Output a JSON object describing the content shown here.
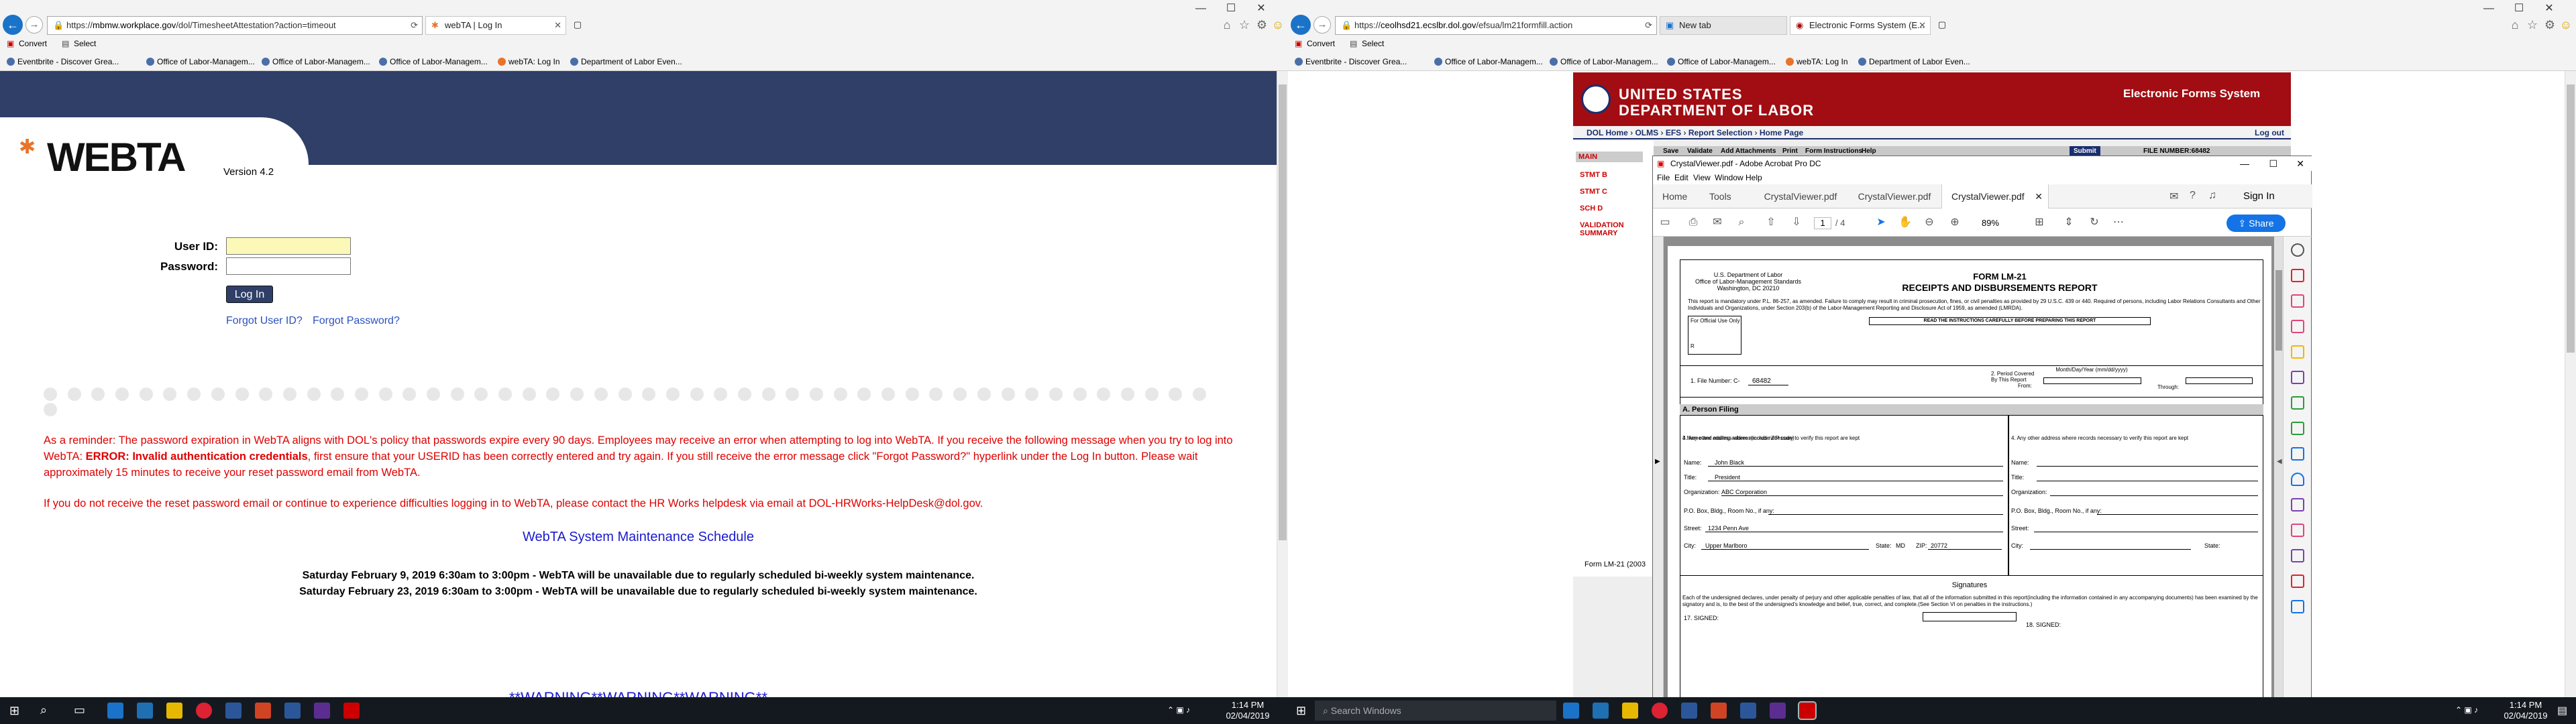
{
  "left_browser": {
    "url_prefix": "https://",
    "url_host": "mbmw.workplace.gov",
    "url_path": "/dol/TimesheetAttestation?action=timeout",
    "tab_title": "webTA | Log In",
    "cmd_convert": "Convert",
    "cmd_select": "Select",
    "favorites": [
      "Eventbrite - Discover Grea...",
      "Office of Labor-Managem...",
      "Office of Labor-Managem...",
      "Office of Labor-Managem...",
      "webTA: Log In",
      "Department of Labor Even..."
    ]
  },
  "webta": {
    "logo": "WEBTA",
    "version": "Version 4.2",
    "user_id_label": "User ID:",
    "password_label": "Password:",
    "login_button": "Log In",
    "forgot_user": "Forgot User ID?",
    "forgot_password": "Forgot Password?",
    "notice_p1_a": "As a reminder: The password expiration in WebTA aligns with DOL's policy that passwords expire every 90 days. Employees may receive an error when attempting to log into WebTA. If you receive the following message when you try to log into WebTA: ",
    "notice_p1_err": "ERROR: Invalid authentication credentials",
    "notice_p1_b": ", first ensure that your USERID has been correctly entered and try again. If you still receive the error message click \"Forgot Password?\" hyperlink under the Log In button. Please wait approximately 15 minutes to receive your reset password email from WebTA.",
    "notice_p2": "If you do not receive the reset password email or continue to experience difficulties logging in to WebTA, please contact the HR Works helpdesk via email at DOL-HRWorks-HelpDesk@dol.gov.",
    "maint_title": "WebTA System Maintenance Schedule",
    "maint_line1": "Saturday February 9, 2019 6:30am to 3:00pm - WebTA will be unavailable due to regularly scheduled bi-weekly system maintenance.",
    "maint_line2": "Saturday February 23, 2019 6:30am to 3:00pm - WebTA will be unavailable due to regularly scheduled bi-weekly system maintenance.",
    "warning": "**WARNING**WARNING**WARNING**"
  },
  "right_browser": {
    "url_prefix": "https://",
    "url_host": "ceolhsd21.ecslbr.dol.gov",
    "url_path": "/efsua/lm21formfill.action",
    "tab1_title": "New tab",
    "tab2_title": "Electronic Forms System (E...",
    "cmd_convert": "Convert",
    "cmd_select": "Select",
    "favorites": [
      "Eventbrite - Discover Grea...",
      "Office of Labor-Managem...",
      "Office of Labor-Managem...",
      "Office of Labor-Managem...",
      "webTA: Log In",
      "Department of Labor Even..."
    ]
  },
  "dol": {
    "agency_line1": "UNITED STATES",
    "agency_line2": "DEPARTMENT OF LABOR",
    "system_title": "Electronic Forms System",
    "nav_home": "DOL Home",
    "nav_olms": "OLMS",
    "nav_efs": "EFS",
    "nav_report": "Report Selection",
    "nav_homepage": "Home Page",
    "logout": "Log out",
    "side_items": [
      "MAIN",
      "STMT B",
      "STMT C",
      "SCH D",
      "VALIDATION SUMMARY"
    ],
    "form_buttons": [
      "Save",
      "Validate",
      "Add Attachments",
      "Print",
      "Form Instructions",
      "Help"
    ],
    "submit": "Submit",
    "file_number_label": "FILE NUMBER:68482",
    "footer": "Form LM-21 (2003"
  },
  "acrobat": {
    "title": "CrystalViewer.pdf - Adobe Acrobat Pro DC",
    "menu": [
      "File",
      "Edit",
      "View",
      "Window",
      "Help"
    ],
    "tab_home": "Home",
    "tab_tools": "Tools",
    "doc_tabs": [
      "CrystalViewer.pdf",
      "CrystalViewer.pdf",
      "CrystalViewer.pdf"
    ],
    "sign_in": "Sign In",
    "page_current": "1",
    "page_total": "/ 4",
    "zoom": "89%",
    "share": "Share"
  },
  "pdf": {
    "agency1": "U.S. Department of Labor",
    "agency2": "Office of Labor-Management Standards",
    "agency3": "Washington, DC 20210",
    "form_no": "FORM LM-21",
    "form_title": "RECEIPTS AND DISBURSEMENTS REPORT",
    "mandatory": "This report is mandatory under P.L. 86-257, as amended. Failure to comply may result in criminal prosecution, fines, or civil penalties as provided by 29 U.S.C. 439 or 440. Required of persons, including Labor Relations Consultants and Other Individuals and Organizations, under Section 203(b) of the Labor-Management Reporting and Disclosure Act of 1959, as amended (LMRDA).",
    "read_instr": "READ THE INSTRUCTIONS CAREFULLY BEFORE PREPARING THIS REPORT",
    "official_use": "For Official Use Only",
    "official_r": "R",
    "file_number_label": "1. File Number: C-",
    "file_number": "68482",
    "period_label": "2. Period Covered By This Report",
    "period_from": "From:",
    "period_through": "Through:",
    "month_day_year": "Month/Day/Year (mm/dd/yyyy)",
    "section_a": "A. Person Filing",
    "name_addr_label": "3.Name and mailing address(include ZIP code)",
    "other_addr_label": "4. Any other address where records necessary to verify this report are kept",
    "name_label": "Name:",
    "name_value": "John Black",
    "title_label": "Title:",
    "title_value": "President",
    "org_label": "Organization:",
    "org_value": "ABC Corporation",
    "pobox_label": "P.O. Box, Bldg., Room No., if any:",
    "street_label": "Street:",
    "street_value": "1234 Penn Ave",
    "city_label": "City:",
    "city_value": "Upper Marlboro",
    "state_label": "State:",
    "state_value": "MD",
    "zip_label": "ZIP:",
    "zip_value": "20772",
    "signatures": "Signatures",
    "penalty": "Each of the undersigned declares, under penalty of perjury and other applicable penalties of law, that all of the information submitted in this report(including the information contained in any accompanying documents) has been examined by the signatory and is, to the best of the undersigned's knowledge and belief, true, correct, and complete.(See Section VI on penalties in the instructions.)",
    "signed17": "17. SIGNED:",
    "signed18": "18. SIGNED:"
  },
  "taskbar": {
    "left_time": "1:14 PM",
    "left_date": "02/04/2019",
    "search_placeholder": "Search Windows",
    "right_time": "1:14 PM",
    "right_date": "02/04/2019"
  },
  "colors": {
    "webta_navy": "#2f3f67",
    "dol_red": "#a10d12",
    "notice_red": "#e00000",
    "link_blue": "#2a52be",
    "acrobat_blue": "#1473e6",
    "taskbar": "#14191f"
  }
}
